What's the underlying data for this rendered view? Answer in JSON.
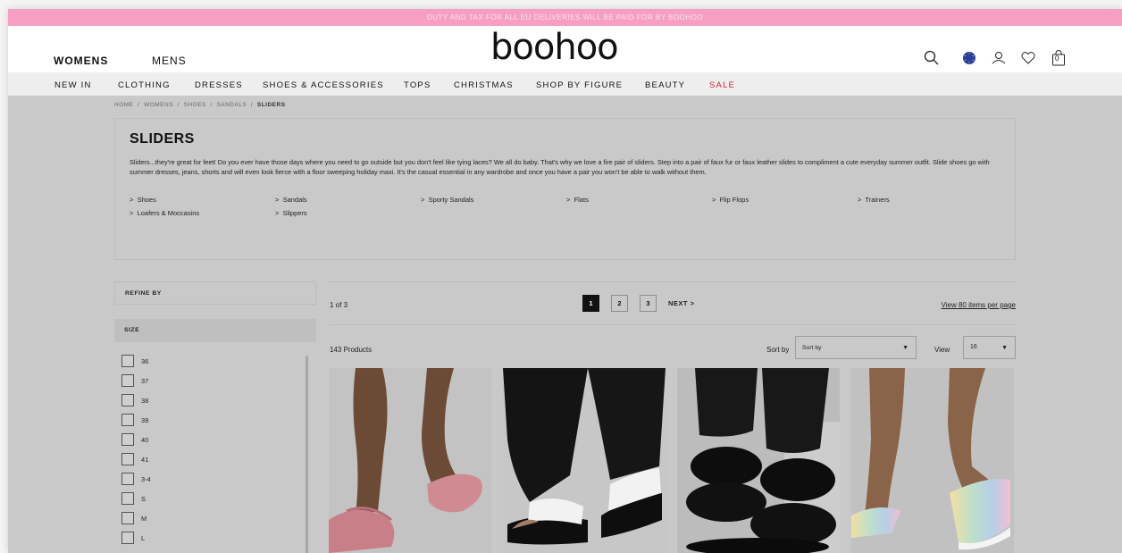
{
  "promo": {
    "text": "DUTY AND TAX FOR ALL EU DELIVERIES WILL BE PAID FOR BY BOOHOO"
  },
  "header": {
    "womens": "WOMENS",
    "mens": "MENS",
    "logo": "boohoo",
    "bag_count": "0",
    "icons": [
      "search-icon",
      "region-flag-icon",
      "account-icon",
      "wishlist-icon",
      "bag-icon"
    ]
  },
  "nav": {
    "items": [
      "NEW IN",
      "CLOTHING",
      "DRESSES",
      "SHOES & ACCESSORIES",
      "TOPS",
      "CHRISTMAS",
      "SHOP BY FIGURE",
      "BEAUTY",
      "SALE"
    ]
  },
  "breadcrumb": {
    "home": "HOME",
    "sep": "/",
    "womens": "WOMENS",
    "shoes": "SHOES",
    "sandals": "SANDALS",
    "current": "SLIDERS"
  },
  "category": {
    "title": "SLIDERS",
    "description": "Sliders...they're great for feet! Do you ever have those days where you need to go outside but you don't feel like tying laces? We all do baby. That's why we love a fire pair of sliders. Step into a pair of faux fur or faux leather slides to compliment a cute everyday summer outfit. Slide shoes go with summer dresses, jeans, shorts and will even look fierce with a floor sweeping holiday maxi. It's the casual essential in any wardrobe and once you have a pair you won't be able to walk without them.",
    "links": [
      "Shoes",
      "Sandals",
      "Sporty Sandals",
      "Flats",
      "Flip Flops",
      "Trainers",
      "Loafers & Moccasins",
      "Slippers"
    ]
  },
  "sidebar": {
    "refine": "REFINE BY",
    "size_heading": "SIZE",
    "sizes": [
      "36",
      "37",
      "38",
      "39",
      "40",
      "41",
      "3-4",
      "S",
      "M",
      "L"
    ]
  },
  "toolbar": {
    "page_of": "1 of 3",
    "pages": [
      "1",
      "2",
      "3"
    ],
    "current_page": "1",
    "next": "NEXT >",
    "view_all": "View 80 items per page",
    "product_count": "143 Products",
    "sort_label": "Sort by",
    "sort_value": "Sort by",
    "view_label": "View",
    "view_value": "16"
  },
  "products": [
    {
      "name": "pink faux fur slider",
      "color": "#d9939b"
    },
    {
      "name": "black and white slogan slider",
      "color": "#111111"
    },
    {
      "name": "black teddy double strap slider",
      "color": "#151515"
    },
    {
      "name": "pastel rainbow slider",
      "color": "#b9d6c7"
    }
  ],
  "colors": {
    "promo": "#f79fc3",
    "sale": "#d0243a",
    "flag": "#2a3f9b"
  }
}
